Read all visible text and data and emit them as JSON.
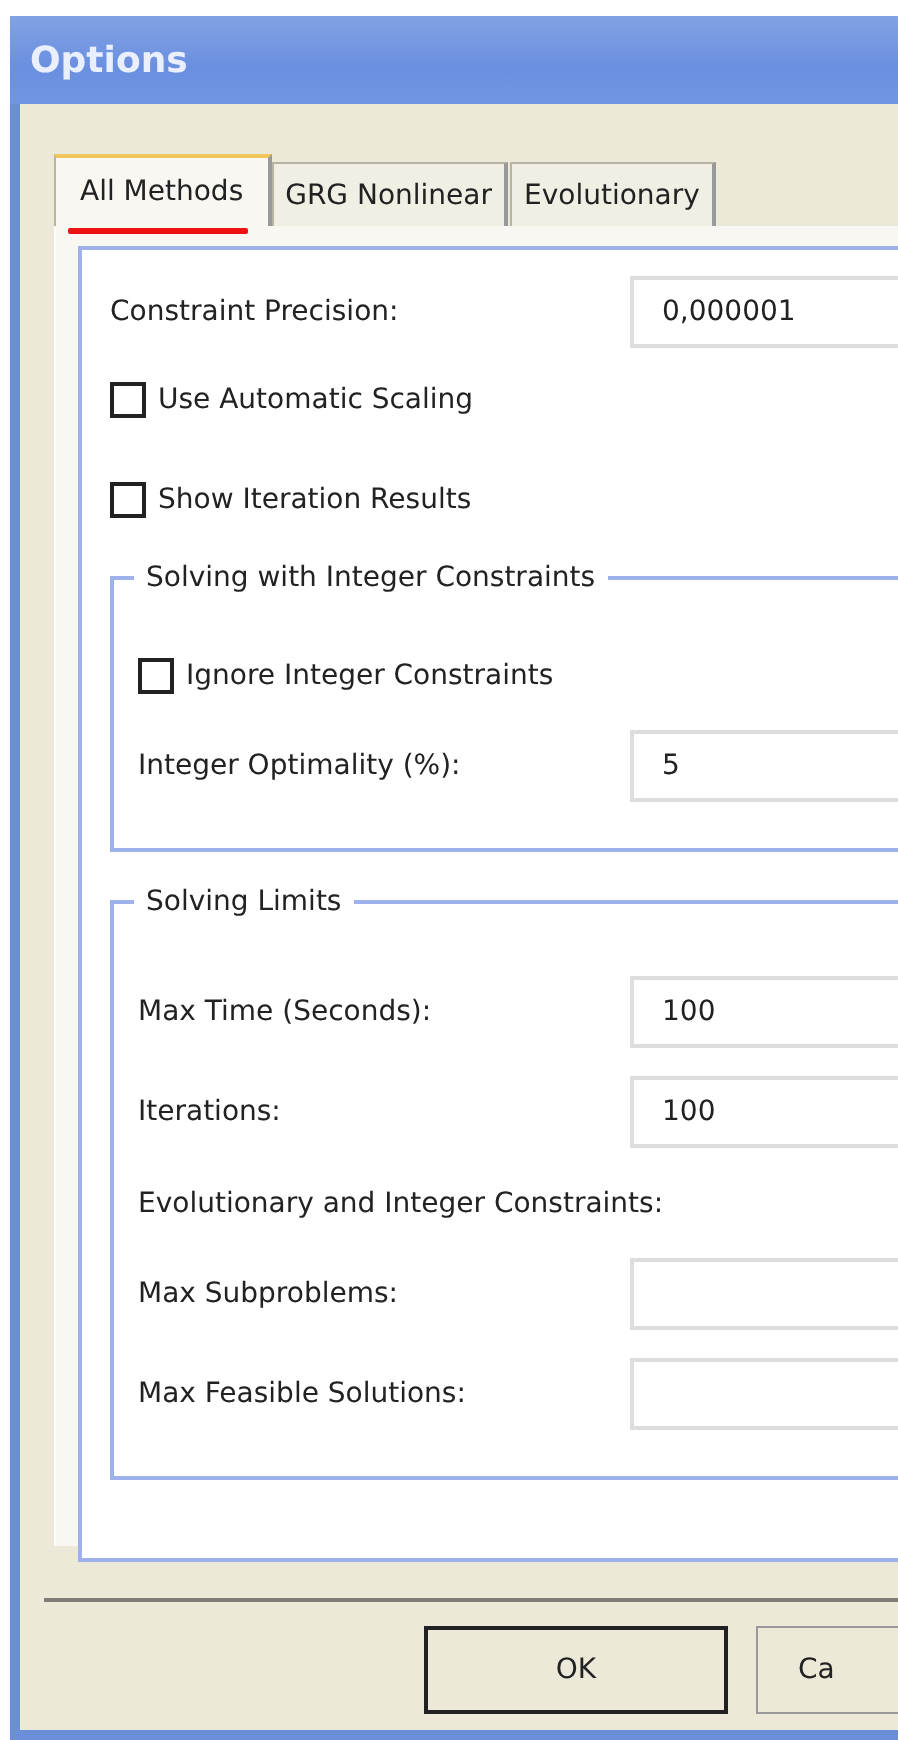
{
  "window": {
    "title": "Options"
  },
  "tabs": [
    {
      "label": "All Methods",
      "selected": true
    },
    {
      "label": "GRG Nonlinear",
      "selected": false
    },
    {
      "label": "Evolutionary",
      "selected": false
    }
  ],
  "panel": {
    "items": [
      {
        "kind": "field",
        "label": "Constraint Precision:",
        "value": "0,000001"
      },
      {
        "kind": "checkbox",
        "label": "Use Automatic Scaling",
        "checked": false
      },
      {
        "kind": "checkbox",
        "label": "Show Iteration Results",
        "checked": false
      },
      {
        "kind": "group",
        "title": "Solving with Integer Constraints",
        "items": [
          {
            "kind": "checkbox",
            "label": "Ignore Integer Constraints",
            "checked": false
          },
          {
            "kind": "field",
            "label": "Integer Optimality (%):",
            "value": "5"
          }
        ]
      },
      {
        "kind": "group",
        "title": "Solving Limits",
        "items": [
          {
            "kind": "field",
            "label": "Max Time (Seconds):",
            "value": "100"
          },
          {
            "kind": "field",
            "label": "Iterations:",
            "value": "100"
          },
          {
            "kind": "note",
            "label": "Evolutionary and Integer Constraints:"
          },
          {
            "kind": "field",
            "label": "Max Subproblems:"
          },
          {
            "kind": "field",
            "label": "Max Feasible Solutions:"
          }
        ]
      }
    ]
  },
  "buttons": [
    {
      "label": "OK",
      "default": true
    },
    {
      "label": "Ca",
      "default": false
    }
  ]
}
